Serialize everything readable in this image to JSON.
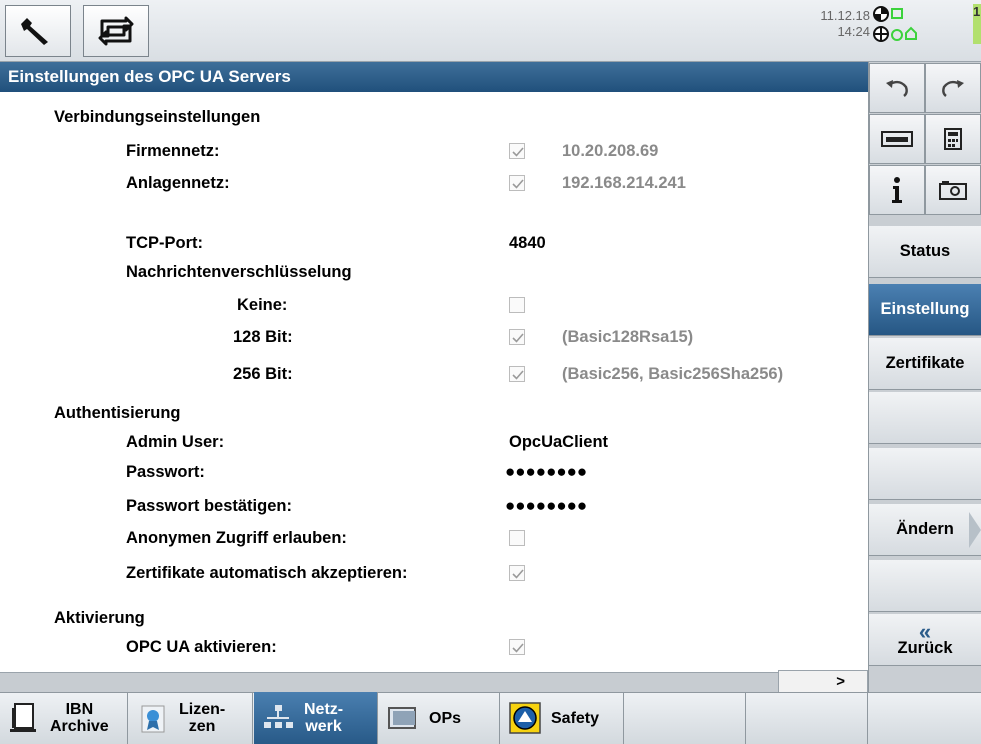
{
  "header": {
    "date": "11.12.18",
    "time": "14:24",
    "channel_label": "1",
    "icons": [
      "wrench-icon",
      "cycle-icon"
    ]
  },
  "title": "Einstellungen des OPC UA Servers",
  "sections": {
    "connection": {
      "heading": "Verbindungseinstellungen",
      "firmennetz_label": "Firmennetz:",
      "firmennetz_value": "10.20.208.69",
      "anlagennetz_label": "Anlagennetz:",
      "anlagennetz_value": "192.168.214.241",
      "tcp_label": "TCP-Port:",
      "tcp_value": "4840",
      "encryption_heading": "Nachrichtenverschlüsselung",
      "keine_label": "Keine:",
      "bit128_label": "128 Bit:",
      "bit128_value": "(Basic128Rsa15)",
      "bit256_label": "256 Bit:",
      "bit256_value": "(Basic256, Basic256Sha256)"
    },
    "auth": {
      "heading": "Authentisierung",
      "admin_label": "Admin User:",
      "admin_value": "OpcUaClient",
      "pw_label": "Passwort:",
      "pw_value": "●●●●●●●●",
      "pw_confirm_label": "Passwort bestätigen:",
      "pw_confirm_value": "●●●●●●●●",
      "anon_label": "Anonymen Zugriff erlauben:",
      "cert_label": "Zertifikate automatisch akzeptieren:"
    },
    "activation": {
      "heading": "Aktivierung",
      "opc_label": "OPC UA aktivieren:"
    }
  },
  "checkboxes": {
    "firmennetz": true,
    "anlagennetz": true,
    "keine": false,
    "bit128": true,
    "bit256": true,
    "anon": false,
    "cert": true,
    "opc": true
  },
  "scroll": {
    "arrow": ">"
  },
  "right_softkeys": {
    "status": "Status",
    "einstellung": "Einstellung",
    "zertifikate": "Zertifikate",
    "aendern": "Ändern",
    "zurueck_arrow": "«",
    "zurueck": "Zurück"
  },
  "bottom_softkeys": {
    "ibn_line1": "IBN",
    "ibn_line2": "Archive",
    "lizen_line1": "Lizen-",
    "lizen_line2": "zen",
    "netz_line1": "Netz-",
    "netz_line2": "werk",
    "ops": "OPs",
    "safety": "Safety"
  },
  "colors": {
    "accent": "#2b5c8a",
    "checked_grey": "#8a8a8a",
    "panel": "#d6dbe0"
  }
}
